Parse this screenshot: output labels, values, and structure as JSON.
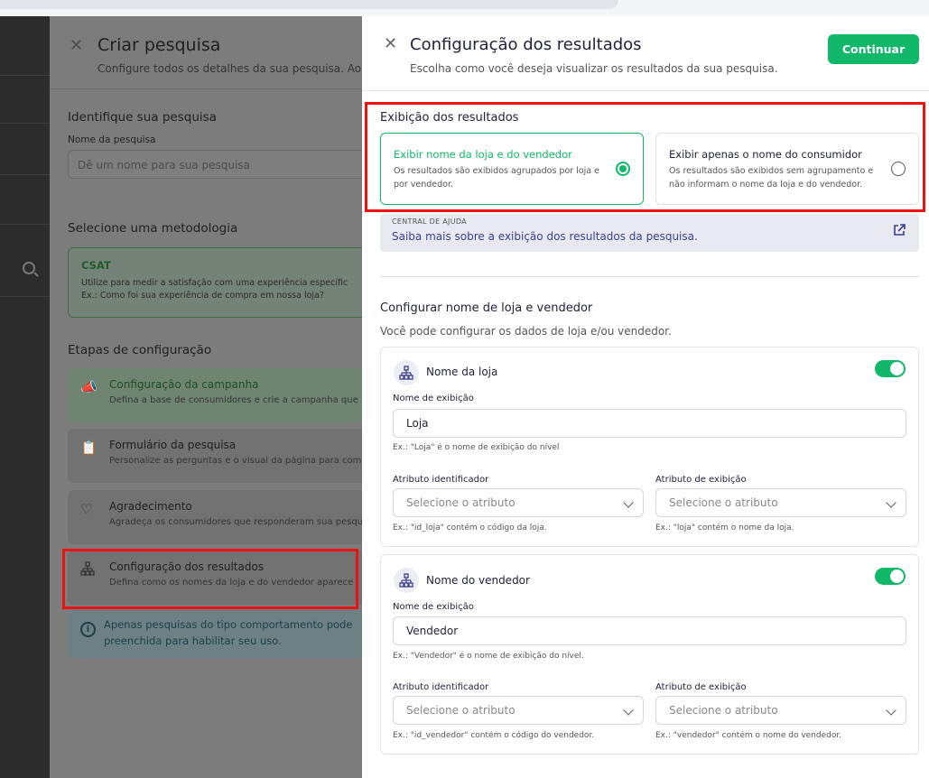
{
  "background_drawer": {
    "title": "Criar pesquisa",
    "subtitle": "Configure todos os detalhes da sua pesquisa. Ao f",
    "identify_heading": "Identifique sua pesquisa",
    "name_label": "Nome da pesquisa",
    "name_placeholder": "Dê um nome para sua pesquisa",
    "methodology_heading": "Selecione uma metodologia",
    "csat": {
      "title": "CSAT",
      "desc_line1": "Utilize para medir a satisfação com uma experiência específic",
      "desc_line2": "Ex.: Como foi sua experiência de compra em nossa loja?"
    },
    "steps_heading": "Etapas de configuração",
    "steps": [
      {
        "title": "Configuração da campanha",
        "desc": "Defina a base de consumidores e crie a campanha que"
      },
      {
        "title": "Formulário da pesquisa",
        "desc": "Personalize as perguntas e o visual da página para com"
      },
      {
        "title": "Agradecimento",
        "desc": "Agradeça os consumidores que responderam sua pesqu"
      },
      {
        "title": "Configuração dos resultados",
        "desc": "Defina como os nomes da loja e do vendedor aparece"
      }
    ],
    "info_line1": "Apenas pesquisas do tipo comportamento pode",
    "info_line2": "preenchida para habilitar seu uso."
  },
  "drawer": {
    "title": "Configuração dos resultados",
    "subtitle": "Escolha como você deseja visualizar os resultados da sua pesquisa.",
    "continue_label": "Continuar",
    "display_heading": "Exibição dos resultados",
    "options": [
      {
        "title": "Exibir nome da loja e do vendedor",
        "desc": "Os resultados são exibidos agrupados por loja e por vendedor.",
        "selected": true
      },
      {
        "title": "Exibir apenas o nome do consumidor",
        "desc": "Os resultados são exibidos sem agrupamento e não informam o nome da loja e do vendedor.",
        "selected": false
      }
    ],
    "help": {
      "kicker": "CENTRAL DE AJUDA",
      "link": "Saiba mais sobre a exibição dos resultados da pesquisa."
    },
    "config_heading": "Configurar nome de loja e vendedor",
    "config_sub": "Você pode configurar os dados de loja e/ou vendedor.",
    "store": {
      "title": "Nome da loja",
      "enabled": true,
      "display_label": "Nome de exibição",
      "display_value": "Loja",
      "display_hint": "Ex.: \"Loja\" é o nome de exibição do nível",
      "id_label": "Atributo identificador",
      "id_placeholder": "Selecione o atributo",
      "id_hint": "Ex.: \"id_loja\" contém o código da loja.",
      "attr_label": "Atributo de exibição",
      "attr_placeholder": "Selecione o atributo",
      "attr_hint": "Ex.: \"loja\" contém o nome da loja."
    },
    "seller": {
      "title": "Nome do vendedor",
      "enabled": true,
      "display_label": "Nome de exibição",
      "display_value": "Vendedor",
      "display_hint": "Ex.: \"Vendedor\" é o nome de exibição do nível.",
      "id_label": "Atributo identificador",
      "id_placeholder": "Selecione o atributo",
      "id_hint": "Ex.: \"id_vendedor\" contém o código do vendedor.",
      "attr_label": "Atributo de exibição",
      "attr_placeholder": "Selecione o atributo",
      "attr_hint": "Ex.: \"vendedor\" contém o nome do vendedor."
    }
  },
  "colors": {
    "accent": "#12b86a",
    "link": "#3a3f8f",
    "highlight": "#ee1111"
  }
}
